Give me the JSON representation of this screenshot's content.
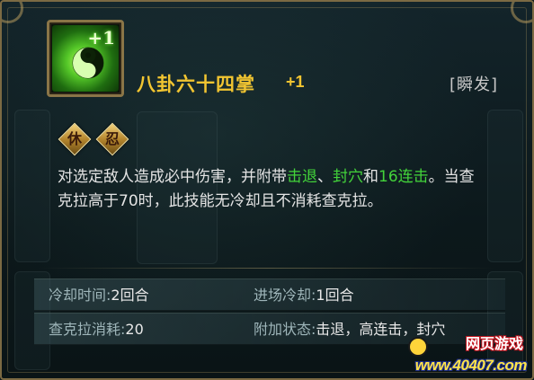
{
  "skill": {
    "name": "八卦六十四掌",
    "level": "+1",
    "cast_type": "[瞬发]",
    "icon": "yin-yang-icon",
    "icon_badge": "+1",
    "tags": [
      "休",
      "忍"
    ]
  },
  "description": {
    "part1": "对选定敌人造成必中伤害，并附带",
    "effect1": "击退",
    "sep1": "、",
    "effect2": "封穴",
    "part2": "和",
    "effect3": "16连击",
    "part3": "。当查克拉高于70时，此技能无冷却且不消耗查克拉。"
  },
  "stats": {
    "cooldown_label": "冷却时间:",
    "cooldown_value": "2回合",
    "entry_cooldown_label": "进场冷却:",
    "entry_cooldown_value": "1回合",
    "chakra_label": "查克拉消耗:",
    "chakra_value": "20",
    "status_label": "附加状态:",
    "status_value": "击退，高连击，封穴"
  },
  "watermark": {
    "title": "网页游戏",
    "url": "www.40407.com"
  },
  "colors": {
    "name": "#f2c531",
    "effect": "#43d43a",
    "frame": "#7c6a43"
  }
}
